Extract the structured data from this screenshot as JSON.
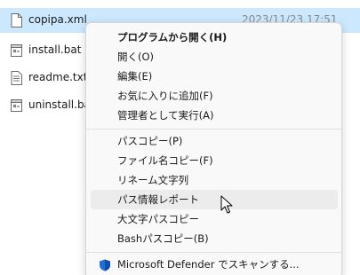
{
  "files": [
    {
      "name": "copipa.xml",
      "date": "2023/11/23 17:51",
      "icon": "document-icon",
      "selected": true
    },
    {
      "name": "install.bat",
      "icon": "batch-file-icon"
    },
    {
      "name": "readme.txt",
      "icon": "text-file-icon"
    },
    {
      "name": "uninstall.bat",
      "icon": "batch-file-icon"
    }
  ],
  "context_menu": {
    "group1": [
      {
        "label": "プログラムから開く(H)",
        "bold": true
      },
      {
        "label": "開く(O)"
      },
      {
        "label": "編集(E)"
      },
      {
        "label": "お気に入りに追加(F)"
      },
      {
        "label": "管理者として実行(A)"
      }
    ],
    "group2": [
      {
        "label": "パスコピー(P)"
      },
      {
        "label": "ファイル名コピー(F)"
      },
      {
        "label": "リネーム文字列"
      },
      {
        "label": "パス情報レポート",
        "hovered": true
      },
      {
        "label": "大文字パスコピー"
      },
      {
        "label": "Bashパスコピー(B)"
      }
    ],
    "group3": [
      {
        "label": "Microsoft Defender でスキャンする...",
        "icon": "defender-shield-icon"
      }
    ]
  },
  "colors": {
    "selection": "#cce8ff",
    "menu_background": "#f9f9f9",
    "hover": "#ececec",
    "defender_blue": "#1e6fd9"
  }
}
